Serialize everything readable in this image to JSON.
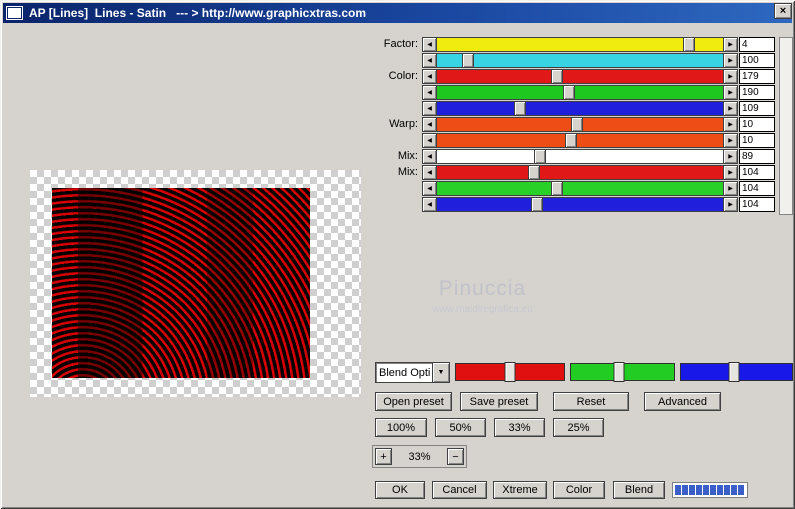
{
  "window": {
    "title": "AP [Lines]  Lines - Satin   --- > http://www.graphicxtras.com",
    "close_glyph": "×"
  },
  "params": {
    "left_arrow": "◀",
    "right_arrow": "▶",
    "rows": [
      {
        "label": "Factor:",
        "value": "4",
        "color": "#f0ec10",
        "pos": 88
      },
      {
        "label": "",
        "value": "100",
        "color": "#38d4e4",
        "pos": 11
      },
      {
        "label": "Color:",
        "value": "179",
        "color": "#e01818",
        "pos": 42
      },
      {
        "label": "",
        "value": "190",
        "color": "#1ec81e",
        "pos": 46
      },
      {
        "label": "",
        "value": "109",
        "color": "#2020dc",
        "pos": 29
      },
      {
        "label": "Warp:",
        "value": "10",
        "color": "#ee4e16",
        "pos": 49
      },
      {
        "label": "",
        "value": "10",
        "color": "#ee4e16",
        "pos": 47
      },
      {
        "label": "Mix:",
        "value": "89",
        "color": "#ffffff",
        "pos": 36
      },
      {
        "label": "Mix:",
        "value": "104",
        "color": "#e01818",
        "pos": 34
      },
      {
        "label": "",
        "value": "104",
        "color": "#28d028",
        "pos": 42
      },
      {
        "label": "",
        "value": "104",
        "color": "#2020dc",
        "pos": 35
      }
    ]
  },
  "watermark": {
    "title": "Pinuccia",
    "subtitle": "www.maidiregrafica.eu"
  },
  "blend": {
    "dropdown_value": "Blend Opti",
    "dropdown_arrow": "▼",
    "channels": [
      {
        "name": "red",
        "color": "#e01010",
        "pos": 50
      },
      {
        "name": "green",
        "color": "#22cc22",
        "pos": 47
      },
      {
        "name": "blue",
        "color": "#1818e8",
        "pos": 48
      }
    ]
  },
  "preset_buttons": {
    "open": "Open preset",
    "save": "Save preset",
    "reset": "Reset",
    "advanced": "Advanced"
  },
  "zoom_buttons": {
    "b100": "100%",
    "b50": "50%",
    "b33": "33%",
    "b25": "25%"
  },
  "zoom_stepper": {
    "plus": "+",
    "value": "33%",
    "minus": "−"
  },
  "actions": {
    "ok": "OK",
    "cancel": "Cancel",
    "xtreme": "Xtreme",
    "color": "Color",
    "blend": "Blend"
  },
  "progress": {
    "segments": 10,
    "color": "#3a5fc8"
  }
}
